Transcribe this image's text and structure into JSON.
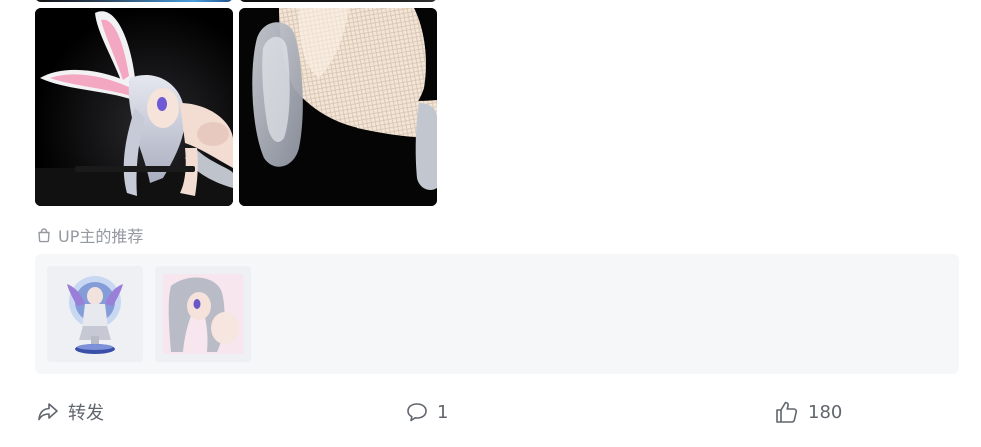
{
  "recommend": {
    "title": "UP主的推荐"
  },
  "actions": {
    "forward_label": "转发",
    "comment_count": "1",
    "like_count": "180"
  },
  "icons": {
    "recommend": "shopping-bag-icon",
    "forward": "share-arrow-icon",
    "comment": "comment-bubble-icon",
    "like": "thumbs-up-icon"
  },
  "colors": {
    "label_gray": "#9499a0",
    "action_gray": "#61666d",
    "panel_bg": "#f6f7f8"
  }
}
